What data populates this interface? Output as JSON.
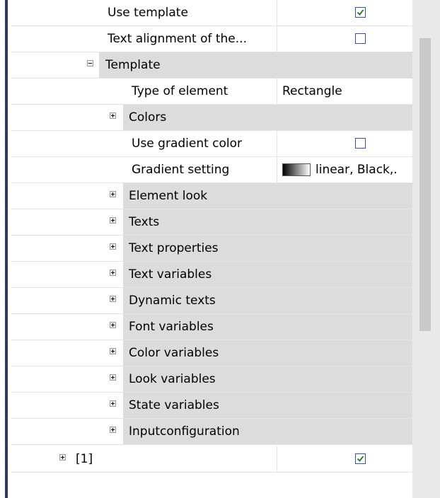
{
  "rows": [
    {
      "label": "Use template",
      "value_type": "checkbox",
      "checked": true
    },
    {
      "label": "Text alignment of the...",
      "value_type": "checkbox",
      "checked": false
    },
    {
      "label": "Template",
      "value_type": "group",
      "expanded": true
    },
    {
      "label": "Type of element",
      "value_type": "text",
      "value": "Rectangle"
    },
    {
      "label": "Colors",
      "value_type": "group",
      "expanded": false
    },
    {
      "label": "Use gradient color",
      "value_type": "checkbox",
      "checked": false
    },
    {
      "label": "Gradient setting",
      "value_type": "gradient",
      "value": "linear,  Black,."
    },
    {
      "label": "Element look",
      "value_type": "group",
      "expanded": false
    },
    {
      "label": "Texts",
      "value_type": "group",
      "expanded": false
    },
    {
      "label": "Text properties",
      "value_type": "group",
      "expanded": false
    },
    {
      "label": "Text variables",
      "value_type": "group",
      "expanded": false
    },
    {
      "label": "Dynamic texts",
      "value_type": "group",
      "expanded": false
    },
    {
      "label": "Font variables",
      "value_type": "group",
      "expanded": false
    },
    {
      "label": "Color variables",
      "value_type": "group",
      "expanded": false
    },
    {
      "label": "Look variables",
      "value_type": "group",
      "expanded": false
    },
    {
      "label": "State variables",
      "value_type": "group",
      "expanded": false
    },
    {
      "label": "Inputconfiguration",
      "value_type": "group",
      "expanded": false
    },
    {
      "label": "[1]",
      "value_type": "checkbox",
      "checked": true
    }
  ],
  "colors": {
    "group_fill": "#dcdcdc",
    "checkbox_border": "#3b4fb0",
    "check_mark": "#1a7a1a"
  }
}
